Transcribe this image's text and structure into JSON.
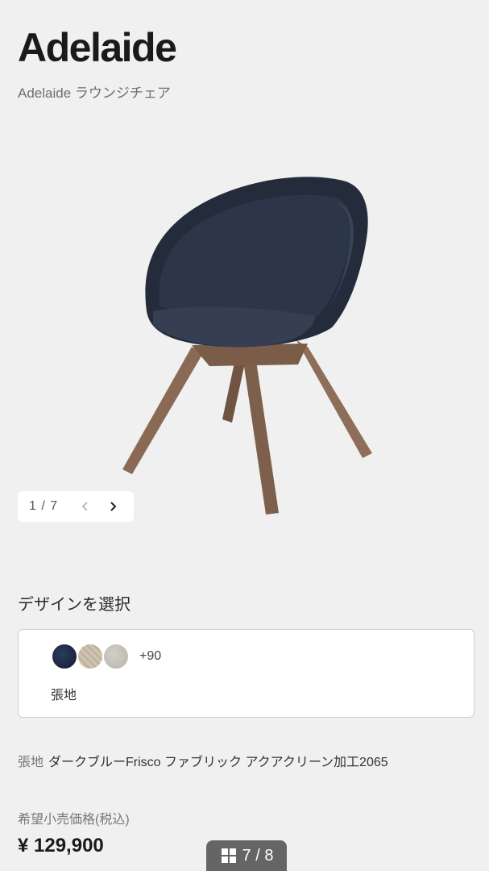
{
  "header": {
    "title": "Adelaide",
    "subtitle": "Adelaide ラウンジチェア"
  },
  "product": {
    "image_icon": "lounge-chair-image"
  },
  "pager": {
    "count": "1 / 7",
    "prev_icon": "chevron-left-icon",
    "next_icon": "chevron-right-icon"
  },
  "design": {
    "section_label": "デザインを選択",
    "swatches": [
      {
        "name": "dark-blue",
        "color": "#1f2a44"
      },
      {
        "name": "beige",
        "color": "#c8bca8"
      },
      {
        "name": "light-grey",
        "color": "#c8c5be"
      }
    ],
    "more": "+90",
    "label": "張地"
  },
  "spec": {
    "key": "張地",
    "value": "ダークブルーFrisco ファブリック アクアクリーン加工2065"
  },
  "pricing": {
    "label": "希望小売価格(税込)",
    "price": "¥ 129,900"
  },
  "gallery": {
    "counter": "7 / 8",
    "icon": "grid-icon"
  }
}
